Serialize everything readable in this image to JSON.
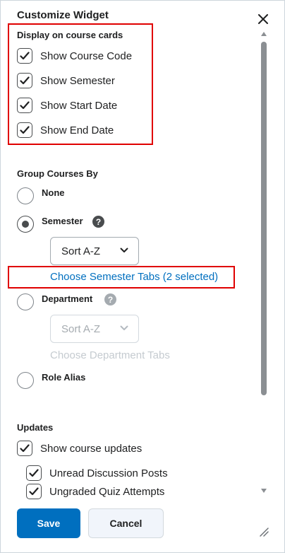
{
  "dialog": {
    "title": "Customize Widget",
    "close_icon": "close-icon"
  },
  "display_section": {
    "label": "Display on course cards",
    "options": [
      {
        "label": "Show Course Code",
        "checked": true
      },
      {
        "label": "Show Semester",
        "checked": true
      },
      {
        "label": "Show Start Date",
        "checked": true
      },
      {
        "label": "Show End Date",
        "checked": true
      }
    ]
  },
  "group_section": {
    "label": "Group Courses By",
    "options": [
      {
        "label": "None",
        "selected": false
      },
      {
        "label": "Semester",
        "selected": true
      },
      {
        "label": "Department",
        "selected": false
      },
      {
        "label": "Role Alias",
        "selected": false
      }
    ],
    "help_icon": "question-circle-icon",
    "semester_sort": "Sort A-Z",
    "semester_tabs_link": "Choose Semester Tabs (2 selected)",
    "department_sort": "Sort A-Z",
    "department_tabs_link": "Choose Department Tabs"
  },
  "updates_section": {
    "label": "Updates",
    "show_updates": {
      "label": "Show course updates",
      "checked": true
    },
    "sub_options": [
      {
        "label": "Unread Discussion Posts",
        "checked": true
      },
      {
        "label": "Ungraded Quiz Attempts",
        "checked": true
      }
    ]
  },
  "footer": {
    "save_label": "Save",
    "cancel_label": "Cancel"
  },
  "colors": {
    "primary": "#006fbf",
    "link": "#006fbf",
    "highlight": "#e00000"
  }
}
